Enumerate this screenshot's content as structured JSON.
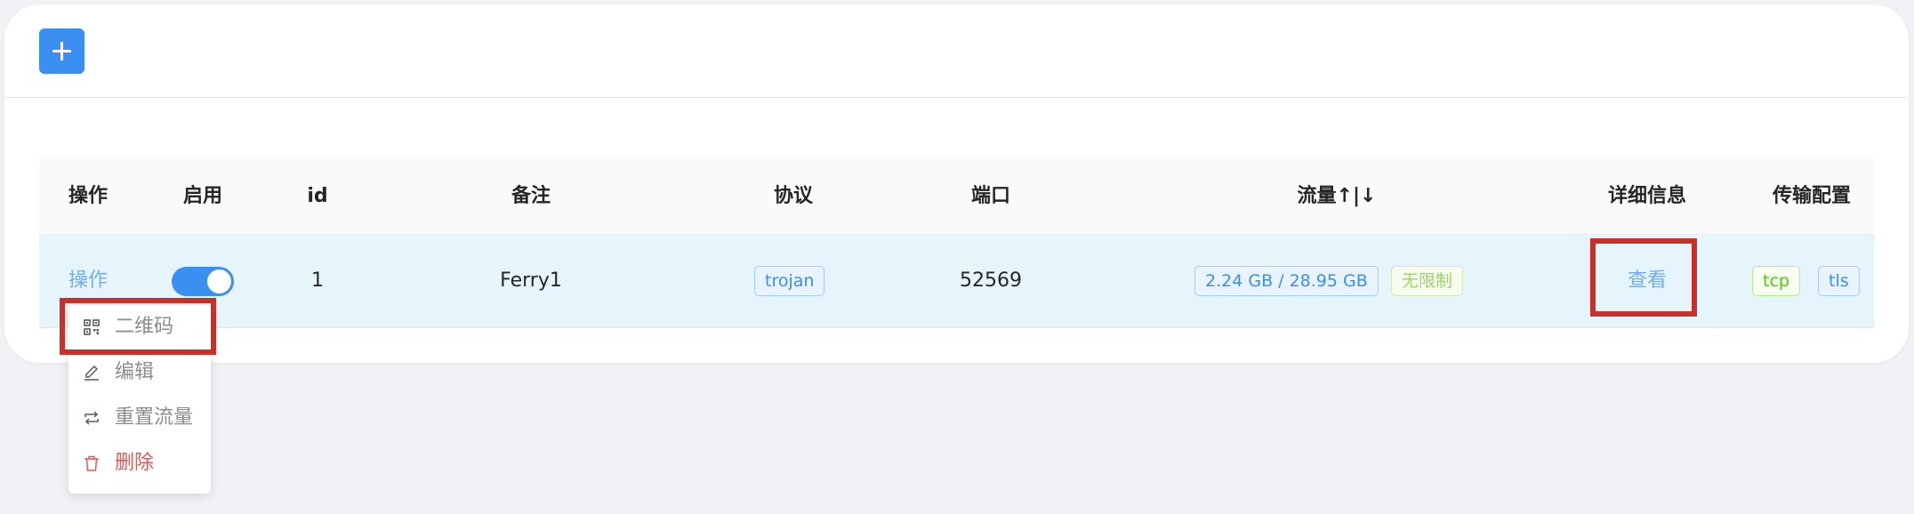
{
  "toolbar": {
    "add_label": "+"
  },
  "table": {
    "headers": [
      "操作",
      "启用",
      "id",
      "备注",
      "协议",
      "端口",
      "流量↑|↓",
      "详细信息",
      "传输配置"
    ],
    "row": {
      "action": "操作",
      "enabled": true,
      "id": "1",
      "remark": "Ferry1",
      "protocol": "trojan",
      "port": "52569",
      "traffic": "2.24 GB / 28.95 GB",
      "limit": "无限制",
      "details": "查看",
      "network": "tcp",
      "security": "tls"
    }
  },
  "dropdown": {
    "items": [
      {
        "label": "二维码",
        "icon": "qrcode-icon"
      },
      {
        "label": "编辑",
        "icon": "edit-icon"
      },
      {
        "label": "重置流量",
        "icon": "reset-icon"
      },
      {
        "label": "删除",
        "icon": "delete-icon"
      }
    ]
  },
  "colors": {
    "primary": "#3b8ff0",
    "danger": "#ef5350",
    "highlight": "#c8302a"
  }
}
